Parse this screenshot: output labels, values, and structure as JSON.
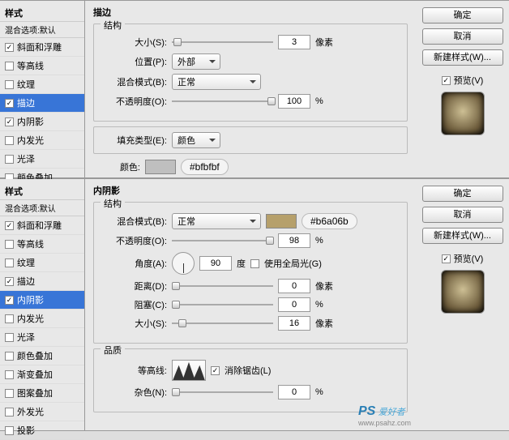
{
  "top": {
    "sidebar": {
      "head": "样式",
      "sub": "混合选项:默认",
      "items": [
        {
          "label": "斜面和浮雕",
          "checked": true,
          "sel": false
        },
        {
          "label": "等高线",
          "checked": false,
          "sel": false
        },
        {
          "label": "纹理",
          "checked": false,
          "sel": false
        },
        {
          "label": "描边",
          "checked": true,
          "sel": true
        },
        {
          "label": "内阴影",
          "checked": true,
          "sel": false
        },
        {
          "label": "内发光",
          "checked": false,
          "sel": false
        },
        {
          "label": "光泽",
          "checked": false,
          "sel": false
        },
        {
          "label": "颜色叠加",
          "checked": false,
          "sel": false
        }
      ]
    },
    "title": "描边",
    "struct": "结构",
    "size": {
      "lbl": "大小(S):",
      "val": "3",
      "unit": "像素",
      "pos": 2
    },
    "position": {
      "lbl": "位置(P):",
      "val": "外部"
    },
    "blend": {
      "lbl": "混合模式(B):",
      "val": "正常"
    },
    "opacity": {
      "lbl": "不透明度(O):",
      "val": "100",
      "unit": "%",
      "pos": 118
    },
    "fill": {
      "lbl": "填充类型(E):",
      "val": "颜色"
    },
    "color": {
      "lbl": "颜色:",
      "hex": "#bfbfbf"
    },
    "right": {
      "ok": "确定",
      "cancel": "取消",
      "new": "新建样式(W)...",
      "preview": "预览(V)"
    }
  },
  "bottom": {
    "sidebar": {
      "head": "样式",
      "sub": "混合选项:默认",
      "items": [
        {
          "label": "斜面和浮雕",
          "checked": true,
          "sel": false
        },
        {
          "label": "等高线",
          "checked": false,
          "sel": false
        },
        {
          "label": "纹理",
          "checked": false,
          "sel": false
        },
        {
          "label": "描边",
          "checked": true,
          "sel": false
        },
        {
          "label": "内阴影",
          "checked": true,
          "sel": true
        },
        {
          "label": "内发光",
          "checked": false,
          "sel": false
        },
        {
          "label": "光泽",
          "checked": false,
          "sel": false
        },
        {
          "label": "颜色叠加",
          "checked": false,
          "sel": false
        },
        {
          "label": "渐变叠加",
          "checked": false,
          "sel": false
        },
        {
          "label": "图案叠加",
          "checked": false,
          "sel": false
        },
        {
          "label": "外发光",
          "checked": false,
          "sel": false
        },
        {
          "label": "投影",
          "checked": false,
          "sel": false
        }
      ]
    },
    "title": "内阴影",
    "struct": "结构",
    "blend": {
      "lbl": "混合模式(B):",
      "val": "正常",
      "hex": "#b6a06b"
    },
    "opacity": {
      "lbl": "不透明度(O):",
      "val": "98",
      "unit": "%",
      "pos": 116
    },
    "angle": {
      "lbl": "角度(A):",
      "val": "90",
      "unit": "度",
      "global": "使用全局光(G)",
      "globalOn": false
    },
    "distance": {
      "lbl": "距离(D):",
      "val": "0",
      "unit": "像素",
      "pos": 0
    },
    "choke": {
      "lbl": "阻塞(C):",
      "val": "0",
      "unit": "%",
      "pos": 0
    },
    "size": {
      "lbl": "大小(S):",
      "val": "16",
      "unit": "像素",
      "pos": 8
    },
    "quality": "品质",
    "contour": {
      "lbl": "等高线:",
      "anti": "消除锯齿(L)",
      "antiOn": true
    },
    "noise": {
      "lbl": "杂色(N):",
      "val": "0",
      "unit": "%",
      "pos": 0
    },
    "right": {
      "ok": "确定",
      "cancel": "取消",
      "new": "新建样式(W)...",
      "preview": "预览(V)"
    }
  },
  "logo": {
    "brand": "PS",
    "tag": "爱好者",
    "url": "www.psahz.com"
  }
}
